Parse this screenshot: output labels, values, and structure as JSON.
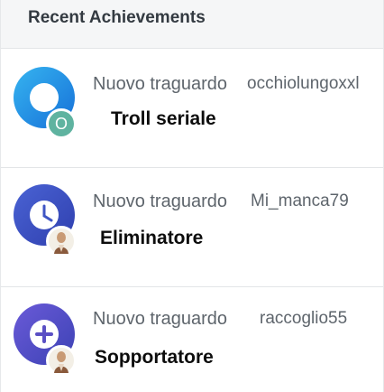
{
  "panel": {
    "title": "Recent Achievements"
  },
  "achievements": [
    {
      "type_label": "Nuovo traguardo",
      "user": "occhiolungoxxl",
      "name": "Troll seriale",
      "badge_icon": "target-ring-icon",
      "avatar_icon": "letter-o-avatar",
      "avatar_letter": "O",
      "badge_color": "#1a8fe0",
      "avatar_color": "#5fb3a0"
    },
    {
      "type_label": "Nuovo traguardo",
      "user": "Mi_manca79",
      "name": "Eliminatore",
      "badge_icon": "clock-ring-icon",
      "avatar_icon": "portrait-avatar",
      "badge_color": "#3f55c4"
    },
    {
      "type_label": "Nuovo traguardo",
      "user": "raccoglio55",
      "name": "Sopportatore",
      "badge_icon": "plus-ring-icon",
      "avatar_icon": "portrait-avatar",
      "badge_color": "#5a4fc4"
    }
  ]
}
